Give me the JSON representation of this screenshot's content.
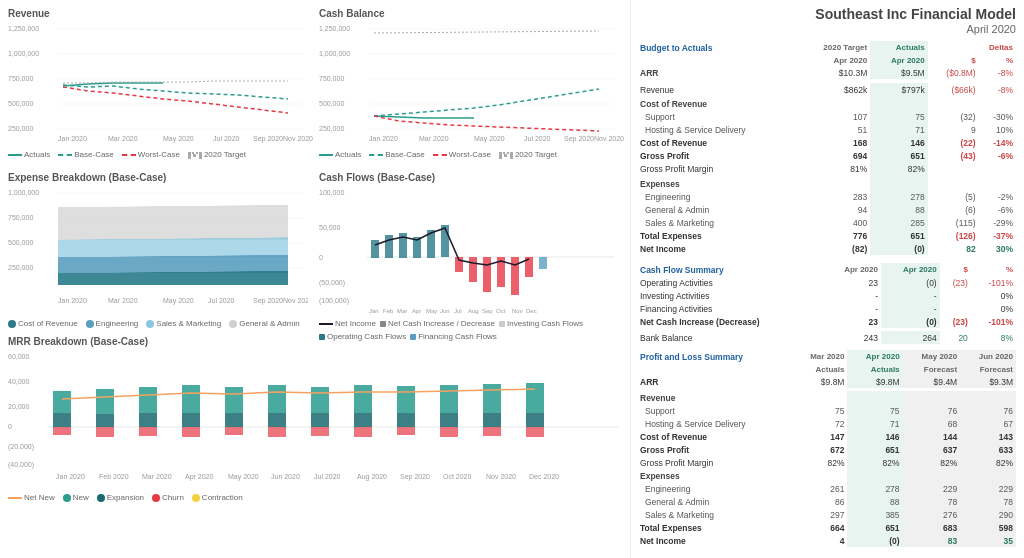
{
  "title": "Southeast Inc Financial Model",
  "subtitle": "April 2020",
  "charts": {
    "revenue": {
      "title": "Revenue",
      "yMax": "1,250,000",
      "y1": "1,000,000",
      "y2": "750,000",
      "y3": "500,000",
      "y4": "250,000",
      "legend": [
        "Actuals",
        "Base-Case",
        "Worst-Case",
        "2020 Target"
      ]
    },
    "cashBalance": {
      "title": "Cash Balance",
      "yMax": "1,250,000",
      "legend": [
        "Actuals",
        "Base-Case",
        "Worst-Case",
        "2020 Target"
      ]
    },
    "expenseBreakdown": {
      "title": "Expense Breakdown (Base-Case)",
      "legend": [
        "Cost of Revenue",
        "Engineering",
        "Sales & Marketing",
        "General & Admin"
      ]
    },
    "cashFlows": {
      "title": "Cash Flows (Base-Case)",
      "legend": [
        "Net Income",
        "Net Cash Increase / Decrease",
        "Investing Cash Flows",
        "Operating Cash Flows",
        "Financing Cash Flows"
      ]
    },
    "mrrBreakdown": {
      "title": "MRR Breakdown (Base-Case)",
      "legend": [
        "Net New",
        "New",
        "Expansion",
        "Churn",
        "Contraction"
      ]
    }
  },
  "budgetTable": {
    "headers": [
      "",
      "2020 Target",
      "Actuals",
      "Deltas",
      ""
    ],
    "subHeaders": [
      "",
      "Apr 2020",
      "Apr 2020",
      "$",
      "%"
    ],
    "rows": [
      {
        "label": "ARR",
        "target": "$10.3M",
        "actuals": "$9.5M",
        "delta_d": "($0.8M)",
        "delta_p": "-8%",
        "bold": false,
        "sub": false
      },
      {
        "label": "",
        "target": "",
        "actuals": "",
        "delta_d": "",
        "delta_p": "",
        "bold": false,
        "sub": false,
        "spacer": true
      },
      {
        "label": "Revenue",
        "target": "$862k",
        "actuals": "$797k",
        "delta_d": "($66k)",
        "delta_p": "-8%",
        "bold": false,
        "sub": false
      },
      {
        "label": "Cost of Revenue",
        "target": "",
        "actuals": "",
        "delta_d": "",
        "delta_p": "",
        "bold": false,
        "sub": false,
        "section": true
      },
      {
        "label": "Support",
        "target": "107",
        "actuals": "75",
        "delta_d": "(32)",
        "delta_p": "-30%",
        "bold": false,
        "sub": true
      },
      {
        "label": "Hosting & Service Delivery",
        "target": "51",
        "actuals": "71",
        "delta_d": "9",
        "delta_p": "10%",
        "bold": false,
        "sub": true
      },
      {
        "label": "Cost of Revenue",
        "target": "168",
        "actuals": "146",
        "delta_d": "(22)",
        "delta_p": "-14%",
        "bold": true,
        "sub": false
      },
      {
        "label": "Gross Profit",
        "target": "694",
        "actuals": "651",
        "delta_d": "(43)",
        "delta_p": "-6%",
        "bold": true,
        "sub": false
      },
      {
        "label": "Gross Profit Margin",
        "target": "81%",
        "actuals": "82%",
        "delta_d": "",
        "delta_p": "",
        "bold": false,
        "sub": false
      },
      {
        "label": "Expenses",
        "target": "",
        "actuals": "",
        "delta_d": "",
        "delta_p": "",
        "bold": false,
        "sub": false,
        "section": true
      },
      {
        "label": "Engineering",
        "target": "283",
        "actuals": "278",
        "delta_d": "(5)",
        "delta_p": "-2%",
        "bold": false,
        "sub": true
      },
      {
        "label": "General & Admin",
        "target": "94",
        "actuals": "88",
        "delta_d": "(6)",
        "delta_p": "-6%",
        "bold": false,
        "sub": true
      },
      {
        "label": "Sales & Marketing",
        "target": "400",
        "actuals": "285",
        "delta_d": "(115)",
        "delta_p": "-29%",
        "bold": false,
        "sub": true
      },
      {
        "label": "Total Expenses",
        "target": "776",
        "actuals": "651",
        "delta_d": "(126)",
        "delta_p": "-37%",
        "bold": true,
        "sub": false
      },
      {
        "label": "Net Income",
        "target": "(82)",
        "actuals": "(0)",
        "delta_d": "82",
        "delta_p": "30%",
        "bold": true,
        "sub": false
      }
    ]
  },
  "cashFlowTable": {
    "headers": [
      "Cash Flow Summary",
      "Apr 2020",
      "Apr 2020",
      "$",
      "%"
    ],
    "rows": [
      {
        "label": "Operating Activities",
        "c1": "23",
        "c2": "(0)",
        "d": "(23)",
        "p": "-101%"
      },
      {
        "label": "Investing Activities",
        "c1": "-",
        "c2": "-",
        "d": "",
        "p": "0%"
      },
      {
        "label": "Financing Activities",
        "c1": "-",
        "c2": "-",
        "d": "",
        "p": "0%"
      },
      {
        "label": "Net Cash Increase (Decrease)",
        "c1": "23",
        "c2": "(0)",
        "d": "(23)",
        "p": "-101%",
        "bold": true
      },
      {
        "label": "",
        "spacer": true
      },
      {
        "label": "Bank Balance",
        "c1": "243",
        "c2": "264",
        "d": "20",
        "p": "8%"
      }
    ]
  },
  "plTable": {
    "headers": [
      "Profit and Loss Summary",
      "Mar 2020",
      "Apr 2020",
      "May 2020",
      "Jun 2020"
    ],
    "colTypes": [
      "",
      "actuals",
      "actuals",
      "forecast",
      "forecast"
    ],
    "subHeaders": [
      "",
      "Actuals",
      "Actuals",
      "Forecast",
      "Forecast"
    ],
    "rows": [
      {
        "label": "ARR",
        "c1": "$9.8M",
        "c2": "$9.8M",
        "c3": "$9.4M",
        "c4": "$9.3M",
        "bold": false
      },
      {
        "label": "",
        "spacer": true
      },
      {
        "label": "Revenue",
        "c1": "",
        "c2": "",
        "c3": "",
        "c4": "",
        "section": true
      },
      {
        "label": "Support",
        "c1": "75",
        "c2": "75",
        "c3": "76",
        "c4": "76",
        "sub": true
      },
      {
        "label": "Hosting & Service Delivery",
        "c1": "72",
        "c2": "71",
        "c3": "68",
        "c4": "67",
        "sub": true
      },
      {
        "label": "Cost of Revenue",
        "c1": "147",
        "c2": "146",
        "c3": "144",
        "c4": "143",
        "bold": true
      },
      {
        "label": "Gross Profit",
        "c1": "672",
        "c2": "651",
        "c3": "637",
        "c4": "633",
        "bold": true
      },
      {
        "label": "Gross Profit Margin",
        "c1": "82%",
        "c2": "82%",
        "c3": "82%",
        "c4": "82%"
      },
      {
        "label": "Expenses",
        "c1": "",
        "c2": "",
        "c3": "",
        "c4": "",
        "section": true
      },
      {
        "label": "Engineering",
        "c1": "261",
        "c2": "278",
        "c3": "229",
        "c4": "229",
        "sub": true
      },
      {
        "label": "General & Admin",
        "c1": "86",
        "c2": "88",
        "c3": "78",
        "c4": "78",
        "sub": true
      },
      {
        "label": "Sales & Marketing",
        "c1": "297",
        "c2": "385",
        "c3": "276",
        "c4": "290",
        "sub": true
      },
      {
        "label": "Total Expenses",
        "c1": "664",
        "c2": "651",
        "c3": "683",
        "c4": "598",
        "bold": true
      },
      {
        "label": "Net Income",
        "c1": "4",
        "c2": "(0)",
        "c3": "83",
        "c4": "35",
        "bold": true
      }
    ]
  }
}
